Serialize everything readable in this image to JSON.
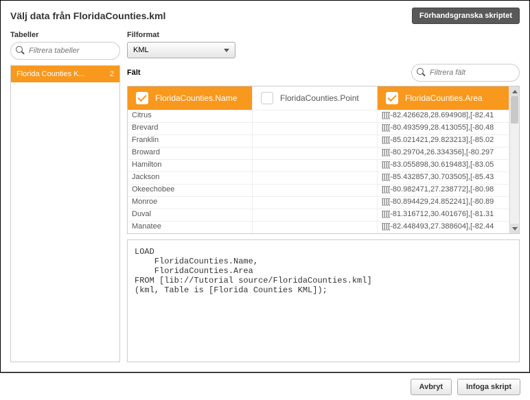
{
  "header": {
    "title": "Välj data från FloridaCounties.kml",
    "preview_button": "Förhandsgranska skriptet"
  },
  "tables": {
    "label": "Tabeller",
    "filter_placeholder": "Filtrera tabeller",
    "items": [
      {
        "name": "Florida Counties K...",
        "count": "2"
      }
    ]
  },
  "format": {
    "label": "Filformat",
    "selected": "KML"
  },
  "fields": {
    "label": "Fält",
    "filter_placeholder": "Filtrera fält",
    "columns": [
      {
        "label": "FloridaCounties.Name",
        "selected": true
      },
      {
        "label": "FloridaCounties.Point",
        "selected": false
      },
      {
        "label": "FloridaCounties.Area",
        "selected": true
      }
    ],
    "rows": [
      {
        "name": "Citrus",
        "point": "",
        "area": "[[[[-82.426628,28.694908],[-82.41"
      },
      {
        "name": "Brevard",
        "point": "",
        "area": "[[[[-80.493599,28.413055],[-80.48"
      },
      {
        "name": "Franklin",
        "point": "",
        "area": "[[[[-85.021421,29.823213],[-85.02"
      },
      {
        "name": "Broward",
        "point": "",
        "area": "[[[[-80.29704,26.334356],[-80.297"
      },
      {
        "name": "Hamilton",
        "point": "",
        "area": "[[[[-83.055898,30.619483],[-83.05"
      },
      {
        "name": "Jackson",
        "point": "",
        "area": "[[[[-85.432857,30.703505],[-85.43"
      },
      {
        "name": "Okeechobee",
        "point": "",
        "area": "[[[[-80.982471,27.238772],[-80.98"
      },
      {
        "name": "Monroe",
        "point": "",
        "area": "[[[[-80.894429,24.852241],[-80.89"
      },
      {
        "name": "Duval",
        "point": "",
        "area": "[[[[-81.316712,30.401676],[-81.31"
      },
      {
        "name": "Manatee",
        "point": "",
        "area": "[[[[-82.448493,27.388604],[-82.44"
      }
    ]
  },
  "script": "LOAD\n    FloridaCounties.Name,\n    FloridaCounties.Area\nFROM [lib://Tutorial source/FloridaCounties.kml]\n(kml, Table is [Florida Counties KML]);",
  "footer": {
    "cancel": "Avbryt",
    "insert": "Infoga skript"
  }
}
